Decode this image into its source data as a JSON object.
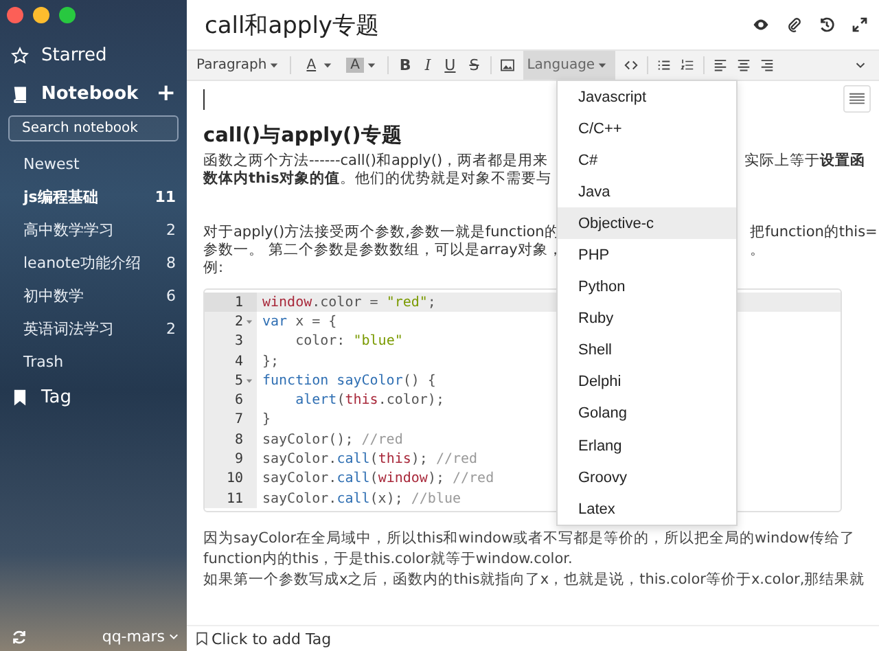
{
  "sidebar": {
    "starred": "Starred",
    "notebook": "Notebook",
    "add": "+",
    "search": {
      "placeholder": "Search notebook"
    },
    "newest": "Newest",
    "notebooks": [
      {
        "name": "js编程基础",
        "count": "11",
        "selected": true
      },
      {
        "name": "高中数学学习",
        "count": "2",
        "selected": false
      },
      {
        "name": "leanote功能介绍",
        "count": "8",
        "selected": false
      },
      {
        "name": "初中数学",
        "count": "6",
        "selected": false
      },
      {
        "name": "英语词法学习",
        "count": "2",
        "selected": false
      }
    ],
    "trash": "Trash",
    "tag": "Tag",
    "user": "qq-mars"
  },
  "note": {
    "title": "call和apply专题"
  },
  "toolbar": [
    {
      "kind": "dropdown",
      "label": "Paragraph",
      "selected": false
    },
    {
      "kind": "separator"
    },
    {
      "kind": "color",
      "label": "A"
    },
    {
      "kind": "highlight",
      "label": "A"
    },
    {
      "kind": "separator"
    },
    {
      "kind": "bold",
      "label": "B"
    },
    {
      "kind": "italic",
      "label": "I"
    },
    {
      "kind": "underline",
      "label": "U"
    },
    {
      "kind": "strike",
      "label": "S"
    },
    {
      "kind": "separator"
    },
    {
      "kind": "image"
    },
    {
      "kind": "dropdown",
      "label": "Language",
      "selected": true
    },
    {
      "kind": "code"
    },
    {
      "kind": "separator"
    },
    {
      "kind": "bullets"
    },
    {
      "kind": "numbers"
    },
    {
      "kind": "separator"
    },
    {
      "kind": "align-left"
    },
    {
      "kind": "align-center"
    },
    {
      "kind": "align-right"
    },
    {
      "kind": "more"
    }
  ],
  "content": {
    "heading": "call()与apply()专题",
    "para1": [
      {
        "left": "函数之两个方法------call()和apply()，两者都是用来",
        "right": "实际上等于**设置函**"
      },
      {
        "left": "**数体内this对象的值**。他们的优势就是对象不需要与"
      }
    ],
    "para2": [
      {
        "left": "对于apply()方法接受两个参数,参数一就是function的",
        "right": "把function的this="
      },
      {
        "left": "参数一。 第二个参数是参数数组，可以是array对象，",
        "right": "。"
      },
      {
        "left": "例:"
      }
    ],
    "code": [
      {
        "number": "1",
        "fold": false,
        "active": true,
        "tokens": [
          {
            "kind": "global",
            "text": "window"
          },
          {
            "kind": "plain",
            "text": ".color = "
          },
          {
            "kind": "string",
            "text": "\"red\""
          },
          {
            "kind": "plain",
            "text": ";"
          }
        ]
      },
      {
        "number": "2",
        "fold": true,
        "active": false,
        "tokens": [
          {
            "kind": "keyword",
            "text": "var"
          },
          {
            "kind": "plain",
            "text": " x = {"
          }
        ]
      },
      {
        "number": "3",
        "fold": false,
        "active": false,
        "tokens": [
          {
            "kind": "plain",
            "text": "    color: "
          },
          {
            "kind": "string",
            "text": "\"blue\""
          }
        ]
      },
      {
        "number": "4",
        "fold": false,
        "active": false,
        "tokens": [
          {
            "kind": "plain",
            "text": "};"
          }
        ]
      },
      {
        "number": "5",
        "fold": true,
        "active": false,
        "tokens": [
          {
            "kind": "keyword",
            "text": "function sayColor"
          },
          {
            "kind": "plain",
            "text": "() {"
          }
        ]
      },
      {
        "number": "6",
        "fold": false,
        "active": false,
        "tokens": [
          {
            "kind": "keyword",
            "text": "    alert"
          },
          {
            "kind": "plain",
            "text": "("
          },
          {
            "kind": "global",
            "text": "this"
          },
          {
            "kind": "plain",
            "text": ".color);"
          }
        ]
      },
      {
        "number": "7",
        "fold": false,
        "active": false,
        "tokens": [
          {
            "kind": "plain",
            "text": "}"
          }
        ]
      },
      {
        "number": "8",
        "fold": false,
        "active": false,
        "tokens": [
          {
            "kind": "plain",
            "text": "sayColor(); "
          },
          {
            "kind": "comment",
            "text": "//red"
          }
        ]
      },
      {
        "number": "9",
        "fold": false,
        "active": false,
        "tokens": [
          {
            "kind": "plain",
            "text": "sayColor."
          },
          {
            "kind": "keyword",
            "text": "call"
          },
          {
            "kind": "plain",
            "text": "("
          },
          {
            "kind": "global",
            "text": "this"
          },
          {
            "kind": "plain",
            "text": "); "
          },
          {
            "kind": "comment",
            "text": "//red"
          }
        ]
      },
      {
        "number": "10",
        "fold": false,
        "active": false,
        "tokens": [
          {
            "kind": "plain",
            "text": "sayColor."
          },
          {
            "kind": "keyword",
            "text": "call"
          },
          {
            "kind": "plain",
            "text": "("
          },
          {
            "kind": "global",
            "text": "window"
          },
          {
            "kind": "plain",
            "text": "); "
          },
          {
            "kind": "comment",
            "text": "//red"
          }
        ]
      },
      {
        "number": "11",
        "fold": false,
        "active": false,
        "tokens": [
          {
            "kind": "plain",
            "text": "sayColor."
          },
          {
            "kind": "keyword",
            "text": "call"
          },
          {
            "kind": "plain",
            "text": "(x); "
          },
          {
            "kind": "comment",
            "text": "//blue"
          }
        ]
      }
    ],
    "para3": [
      "因为sayColor在全局域中，所以this和window或者不写都是等价的，所以把全局的window传给了function内的this，于是this.color就等于window.color.",
      "如果第一个参数写成x之后，函数内的this就指向了x，也就是说，this.color等价于x.color,那结果就"
    ]
  },
  "language_menu": [
    {
      "label": "Javascript",
      "selected": false
    },
    {
      "label": "C/C++",
      "selected": false
    },
    {
      "label": "C#",
      "selected": false
    },
    {
      "label": "Java",
      "selected": false
    },
    {
      "label": "Objective-c",
      "selected": true
    },
    {
      "label": "PHP",
      "selected": false
    },
    {
      "label": "Python",
      "selected": false
    },
    {
      "label": "Ruby",
      "selected": false
    },
    {
      "label": "Shell",
      "selected": false
    },
    {
      "label": "Delphi",
      "selected": false
    },
    {
      "label": "Golang",
      "selected": false
    },
    {
      "label": "Erlang",
      "selected": false
    },
    {
      "label": "Groovy",
      "selected": false
    },
    {
      "label": "Latex",
      "selected": false
    }
  ],
  "tag_bar": {
    "placeholder": "Click to add Tag"
  }
}
